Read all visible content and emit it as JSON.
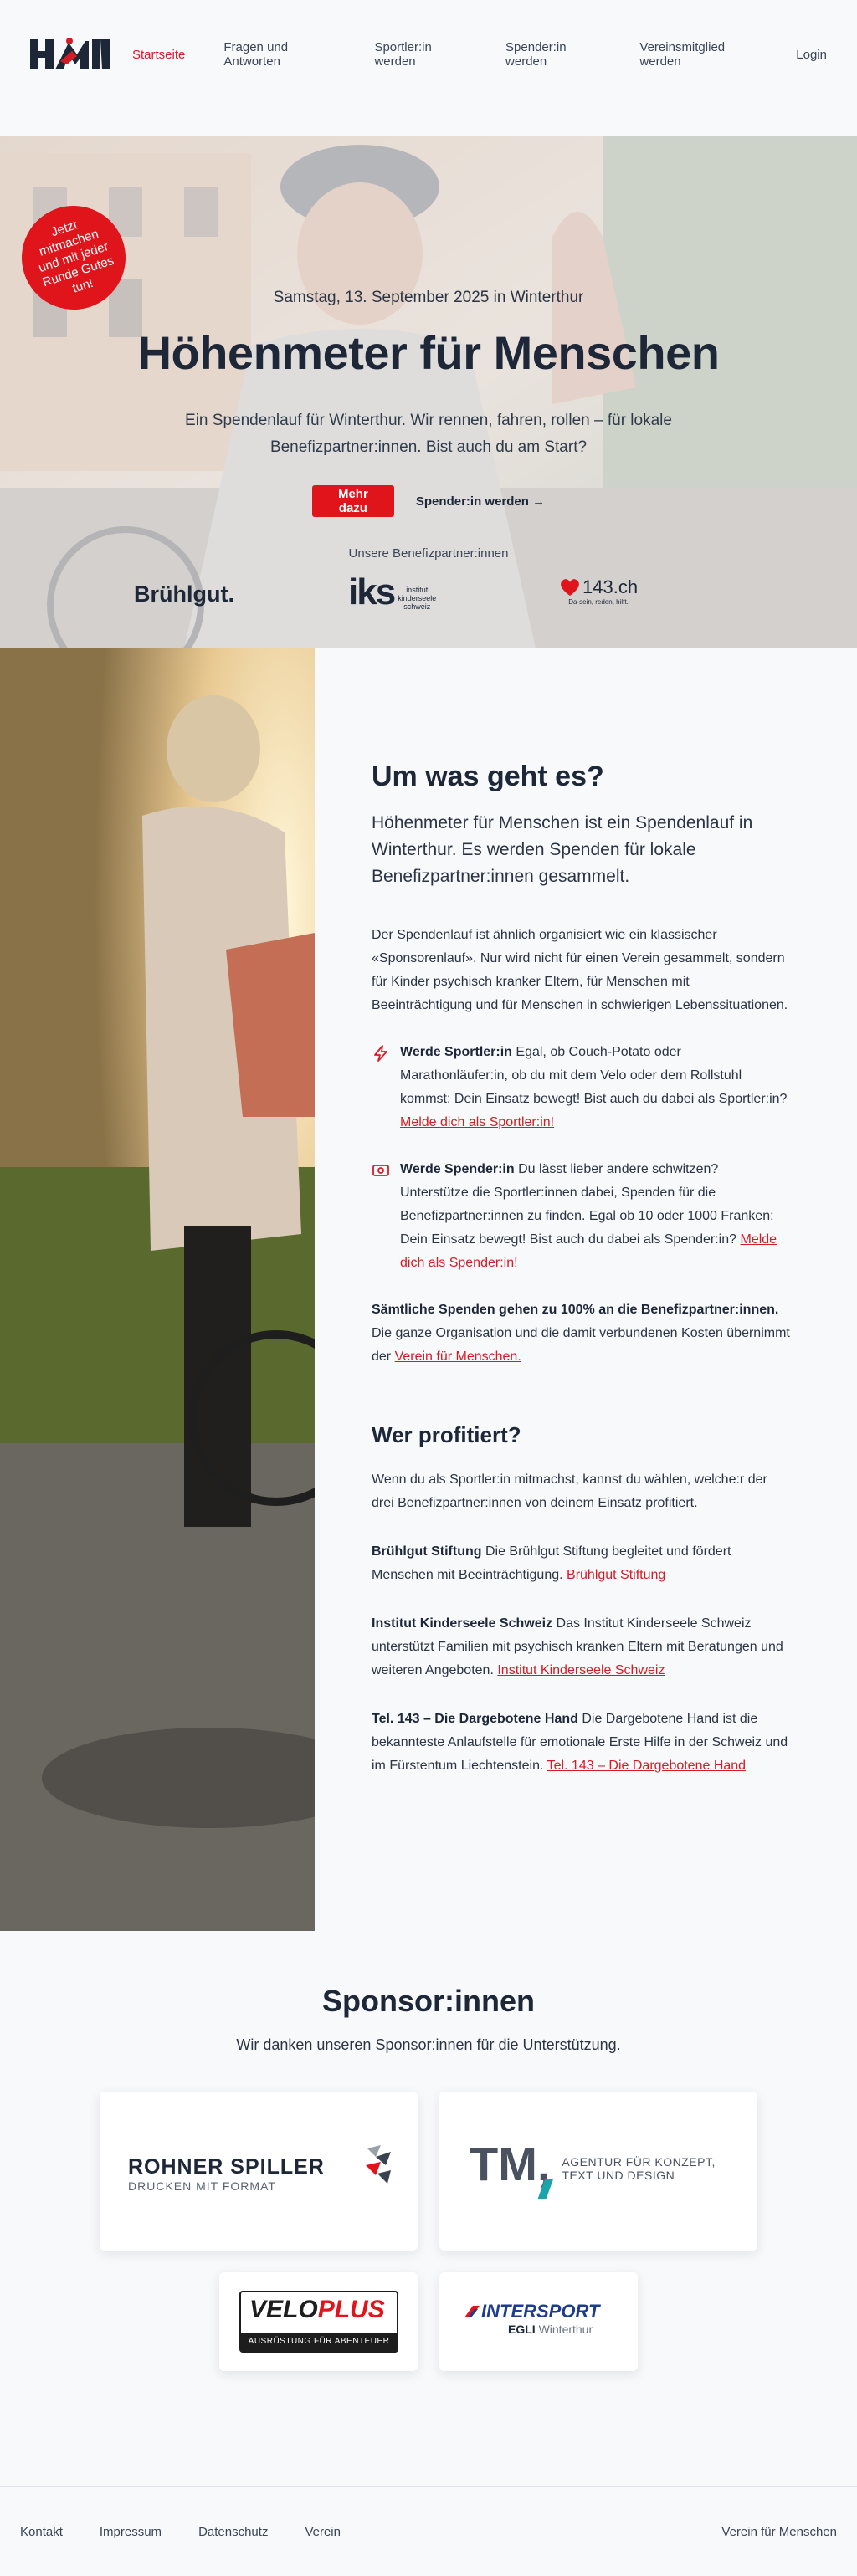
{
  "nav": {
    "logo_alt": "HfM",
    "items": [
      {
        "label": "Startseite",
        "active": true
      },
      {
        "label": "Fragen und Antworten"
      },
      {
        "label": "Sportler:in werden"
      },
      {
        "label": "Spender:in werden"
      },
      {
        "label": "Vereinsmitglied werden"
      }
    ],
    "login": "Login"
  },
  "hero": {
    "badge": "Jetzt mitmachen und mit jeder Runde Gutes tun!",
    "date": "Samstag, 13. September 2025 in Winterthur",
    "title": "Höhenmeter für Menschen",
    "subtitle": "Ein Spendenlauf für Winterthur. Wir rennen, fahren, rollen – für lokale Benefizpartner:innen. Bist auch du am Start?",
    "cta_primary": "Mehr dazu",
    "cta_secondary": "Spender:in werden →",
    "partners_label": "Unsere Benefizpartner:innen",
    "partners": {
      "bruehlgut": "Brühlgut.",
      "iks_short": "ks",
      "iks_lines": [
        "institut",
        "kinderseele",
        "schweiz"
      ],
      "dargebotene": "143.ch",
      "dargebotene_sub": "Da-sein, reden, hilft."
    }
  },
  "about": {
    "title": "Um was geht es?",
    "lead": "Höhenmeter für Menschen ist ein Spendenlauf in Winterthur. Es werden Spenden für lokale Benefizpartner:innen gesammelt.",
    "intro": "Der Spendenlauf ist ähnlich organisiert wie ein klassischer «Sponsorenlauf». Nur wird nicht für einen Verein gesammelt, sondern für Kinder psychisch kranker Eltern, für Menschen mit Beeinträchtigung und für Menschen in schwierigen Lebenssituationen.",
    "sportler": {
      "bold": "Werde Sportler:in",
      "text": " Egal, ob Couch-Potato oder Marathonläufer:in, ob du mit dem Velo oder dem Rollstuhl kommst: Dein Einsatz bewegt! Bist auch du dabei als Sportler:in? ",
      "link": "Melde dich als Sportler:in!"
    },
    "spender": {
      "bold": "Werde Spender:in",
      "text": " Du lässt lieber andere schwitzen? Unterstütze die Sportler:innen dabei, Spenden für die Benefizpartner:innen zu finden. Egal ob 10 oder 1000 Franken: Dein Einsatz bewegt! Bist auch du dabei als Spender:in? ",
      "link": "Melde dich als Spender:in!"
    },
    "note": {
      "bold": "Sämtliche Spenden gehen zu 100% an die Benefizpartner:innen.",
      "text": " Die ganze Organisation und die damit verbundenen Kosten übernimmt der ",
      "link": "Verein für Menschen."
    },
    "profit_title": "Wer profitiert?",
    "profit_intro": "Wenn du als Sportler:in mitmachst, kannst du wählen, welche:r der drei Benefizpartner:innen von deinem Einsatz profitiert.",
    "p1": {
      "bold": "Brühlgut Stiftung",
      "text": " Die Brühlgut Stiftung begleitet und fördert Menschen mit Beeinträchtigung. ",
      "link": "Brühlgut Stiftung"
    },
    "p2": {
      "bold": "Institut Kinderseele Schweiz",
      "text": " Das Institut Kinderseele Schweiz unterstützt Familien mit psychisch kranken Eltern mit Beratungen und weiteren Angeboten. ",
      "link": "Institut Kinderseele Schweiz"
    },
    "p3": {
      "bold": "Tel. 143 – Die Dargebotene Hand",
      "text": " Die Dargebotene Hand ist die bekannteste Anlaufstelle für emotionale Erste Hilfe in der Schweiz und im Fürstentum Liechtenstein. ",
      "link": "Tel. 143 – Die Dargebotene Hand"
    }
  },
  "sponsors": {
    "title": "Sponsor:innen",
    "subtitle": "Wir danken unseren Sponsor:innen für die Unterstützung.",
    "rohner": {
      "name": "ROHNER SPILLER",
      "tag": "DRUCKEN MIT FORMAT"
    },
    "tm": {
      "name": "TM,",
      "tag1": "AGENTUR FÜR KONZEPT,",
      "tag2": "TEXT UND DESIGN"
    },
    "veloplus": {
      "a": "VELO",
      "b": "PLUS",
      "tag": "AUSRÜSTUNG FÜR ABENTEUER"
    },
    "intersport": {
      "name": "INTERSPORT",
      "sub1": "EGLI",
      "sub2": "Winterthur"
    }
  },
  "footer": {
    "links": [
      "Kontakt",
      "Impressum",
      "Datenschutz",
      "Verein"
    ],
    "right": "Verein für Menschen"
  },
  "colors": {
    "accent": "#d41c26",
    "navy": "#1d2738"
  }
}
